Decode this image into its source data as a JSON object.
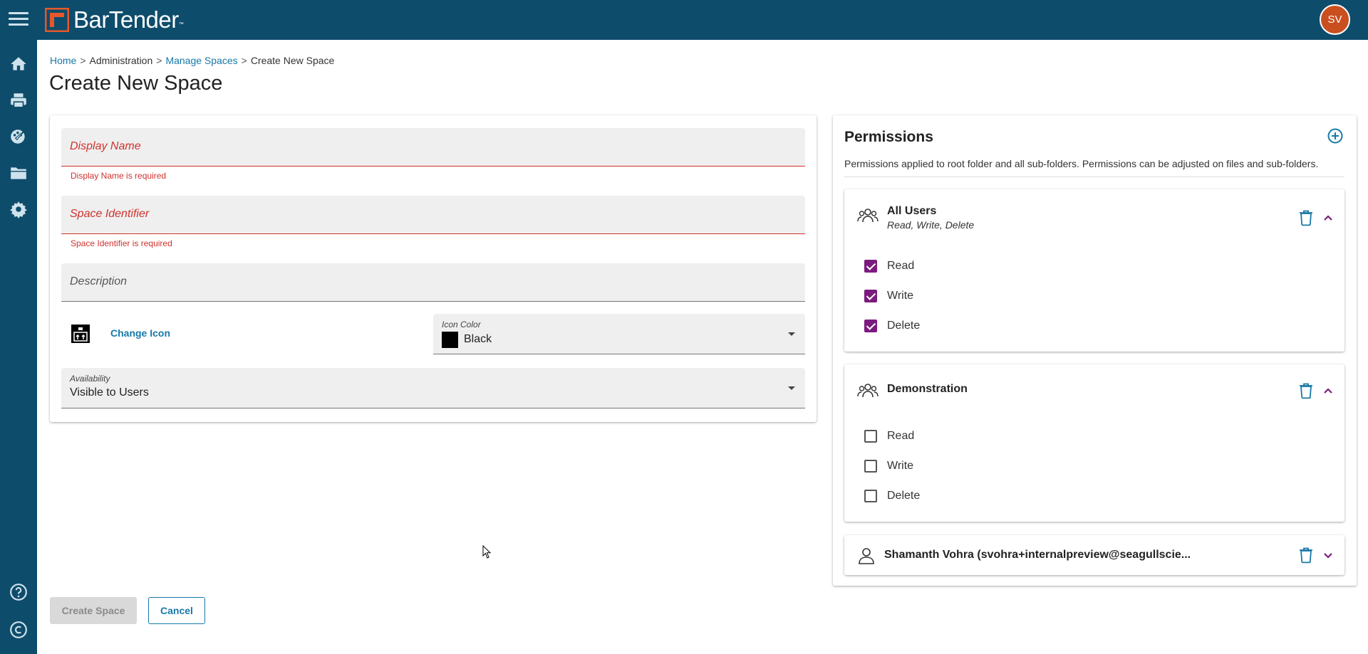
{
  "header": {
    "app_name": "BarTender",
    "trademark": "™",
    "avatar_initials": "SV"
  },
  "breadcrumb": {
    "home": "Home",
    "sep1": ">",
    "admin": "Administration",
    "sep2": ">",
    "manage_spaces": "Manage Spaces",
    "sep3": ">",
    "current": "Create New Space"
  },
  "page": {
    "title": "Create New Space"
  },
  "form": {
    "display_name": {
      "placeholder": "Display Name",
      "error": "Display Name is required"
    },
    "space_identifier": {
      "placeholder": "Space Identifier",
      "error": "Space Identifier is required"
    },
    "description": {
      "placeholder": "Description"
    },
    "change_icon_label": "Change Icon",
    "icon_color": {
      "label": "Icon Color",
      "value": "Black",
      "swatch": "#000000"
    },
    "availability": {
      "label": "Availability",
      "value": "Visible to Users"
    }
  },
  "permissions": {
    "title": "Permissions",
    "description": "Permissions applied to root folder and all sub-folders. Permissions can be adjusted on files and sub-folders.",
    "groups": [
      {
        "name": "All Users",
        "summary": "Read, Write, Delete",
        "items": [
          {
            "label": "Read",
            "checked": true
          },
          {
            "label": "Write",
            "checked": true
          },
          {
            "label": "Delete",
            "checked": true
          }
        ]
      },
      {
        "name": "Demonstration",
        "summary": "",
        "items": [
          {
            "label": "Read",
            "checked": false
          },
          {
            "label": "Write",
            "checked": false
          },
          {
            "label": "Delete",
            "checked": false
          }
        ]
      },
      {
        "name": "Shamanth Vohra (svohra+internalpreview@seagullscie...",
        "summary": "",
        "items": []
      }
    ]
  },
  "actions": {
    "create_label": "Create Space",
    "cancel_label": "Cancel"
  },
  "colors": {
    "header_bg": "#0e4c6b",
    "accent": "#1779a8",
    "error": "#d0312d",
    "checkbox": "#7b1b7e",
    "avatar": "#c94f1f",
    "logo": "#e8572a"
  }
}
